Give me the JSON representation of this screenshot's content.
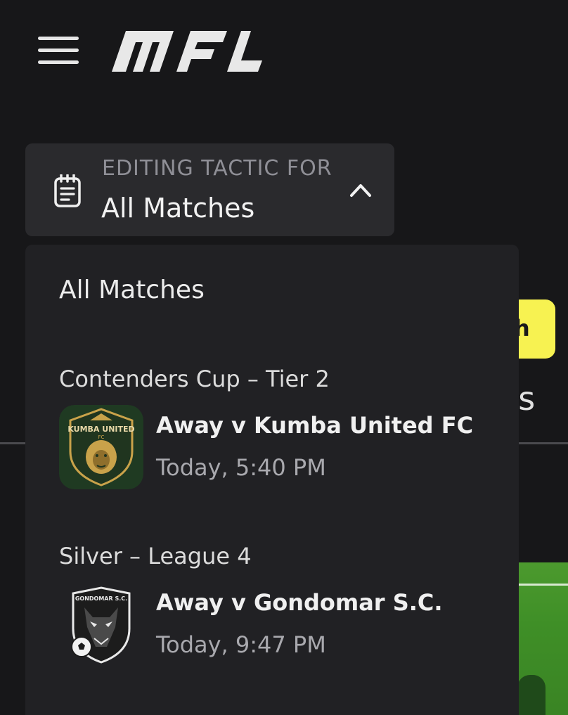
{
  "header": {
    "logo_text": "MFL"
  },
  "selector": {
    "label": "EDITING TACTIC FOR",
    "value": "All Matches"
  },
  "background": {
    "button_partial": "ch",
    "tab_partial": "ons"
  },
  "dropdown": {
    "all_option": "All Matches",
    "groups": [
      {
        "title": "Contenders Cup – Tier 2",
        "match": {
          "title": "Away v Kumba United FC",
          "time": "Today, 5:40 PM",
          "crest_text": "KUMBA UNITED",
          "crest_sub": "FC"
        }
      },
      {
        "title": "Silver – League 4",
        "match": {
          "title": "Away v Gondomar S.C.",
          "time": "Today, 9:47 PM",
          "crest_text": "GONDOMAR S.C."
        }
      }
    ]
  },
  "colors": {
    "background": "#171719",
    "selector_bg": "#2a2a2d",
    "dropdown_bg": "#212124",
    "accent_yellow": "#f7f251",
    "kumba_green": "#1f3a22",
    "kumba_gold": "#c9a24a"
  },
  "icons": {
    "menu": "hamburger-menu-icon",
    "selector": "clipboard-icon",
    "chevron": "chevron-up-icon"
  }
}
